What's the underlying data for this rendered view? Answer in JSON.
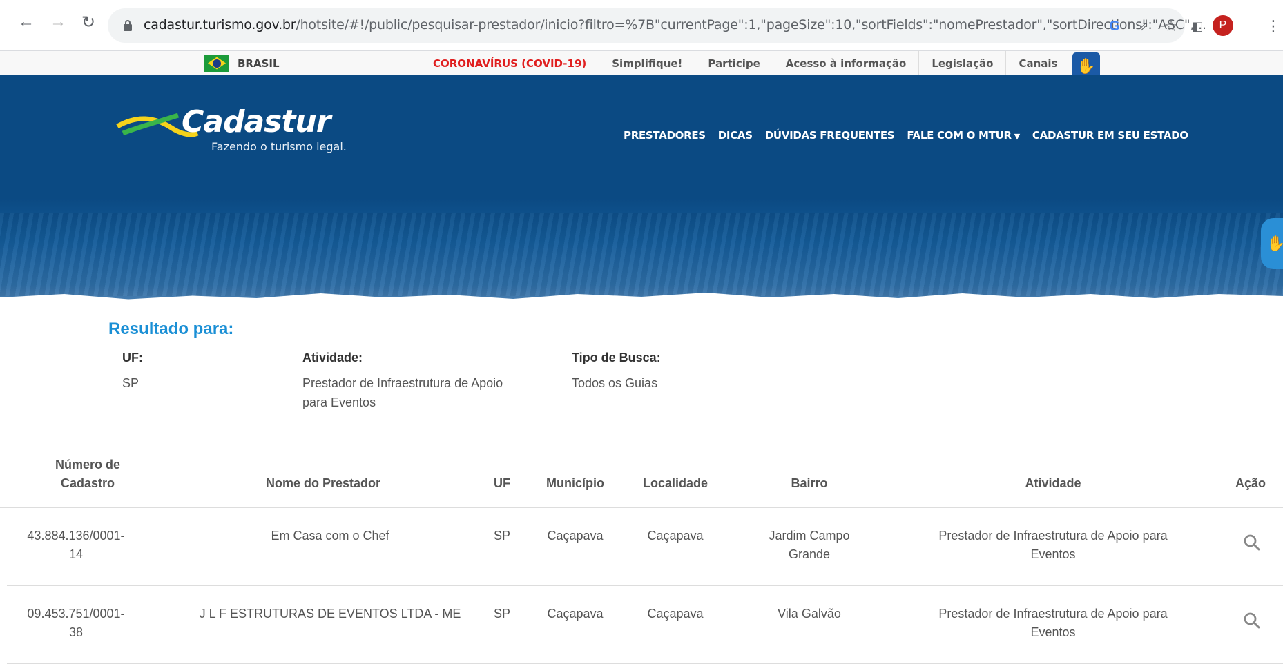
{
  "browser": {
    "url_host": "cadastur.turismo.gov.br",
    "url_path": "/hotsite/#!/public/pesquisar-prestador/inicio?filtro=%7B\"currentPage\":1,\"pageSize\":10,\"sortFields\":\"nomePrestador\",\"sortDirections\":\"ASC\",...",
    "profile_initial": "P"
  },
  "govbar": {
    "country": "BRASIL",
    "links": [
      "CORONAVÍRUS (COVID-19)",
      "Simplifique!",
      "Participe",
      "Acesso à informação",
      "Legislação",
      "Canais"
    ]
  },
  "header": {
    "brand": "Cadastur",
    "tagline": "Fazendo o turismo legal.",
    "nav": [
      "PRESTADORES",
      "DICAS",
      "DÚVIDAS FREQUENTES",
      "FALE COM O MTUR",
      "CADASTUR EM SEU ESTADO"
    ]
  },
  "results": {
    "title": "Resultado para:",
    "filters": [
      {
        "label": "UF:",
        "value": "SP"
      },
      {
        "label": "Atividade:",
        "value": "Prestador de Infraestrutura de Apoio para Eventos"
      },
      {
        "label": "Tipo de Busca:",
        "value": "Todos os Guias"
      }
    ]
  },
  "table": {
    "columns": [
      "Número de Cadastro",
      "Nome do Prestador",
      "UF",
      "Município",
      "Localidade",
      "Bairro",
      "Atividade",
      "Ação"
    ],
    "rows": [
      {
        "numero": "43.884.136/0001-14",
        "nome": "Em Casa com o Chef",
        "uf": "SP",
        "municipio": "Caçapava",
        "localidade": "Caçapava",
        "bairro": "Jardim Campo Grande",
        "atividade": "Prestador de Infraestrutura de Apoio para Eventos"
      },
      {
        "numero": "09.453.751/0001-38",
        "nome": "J L F ESTRUTURAS DE EVENTOS LTDA - ME",
        "uf": "SP",
        "municipio": "Caçapava",
        "localidade": "Caçapava",
        "bairro": "Vila Galvão",
        "atividade": "Prestador de Infraestrutura de Apoio para Eventos"
      }
    ]
  },
  "colors": {
    "hero_blue": "#0b4a83",
    "result_title": "#1a8fd5",
    "covid_red": "#e01f1f"
  }
}
